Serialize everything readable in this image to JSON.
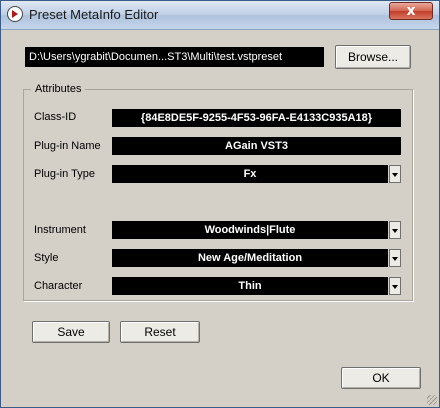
{
  "window": {
    "title": "Preset MetaInfo Editor",
    "close_glyph": "x",
    "app_icon": "cubase-play-icon"
  },
  "path": {
    "value": "D:\\Users\\ygrabit\\Documen...ST3\\Multi\\test.vstpreset",
    "browse_label": "Browse..."
  },
  "attributes": {
    "legend": "Attributes",
    "class_id_label": "Class-ID",
    "class_id_value": "{84E8DE5F-9255-4F53-96FA-E4133C935A18}",
    "plugin_name_label": "Plug-in Name",
    "plugin_name_value": "AGain VST3",
    "plugin_type_label": "Plug-in Type",
    "plugin_type_value": "Fx",
    "instrument_label": "Instrument",
    "instrument_value": "Woodwinds|Flute",
    "style_label": "Style",
    "style_value": "New Age/Meditation",
    "character_label": "Character",
    "character_value": "Thin"
  },
  "buttons": {
    "save": "Save",
    "reset": "Reset",
    "ok": "OK"
  }
}
